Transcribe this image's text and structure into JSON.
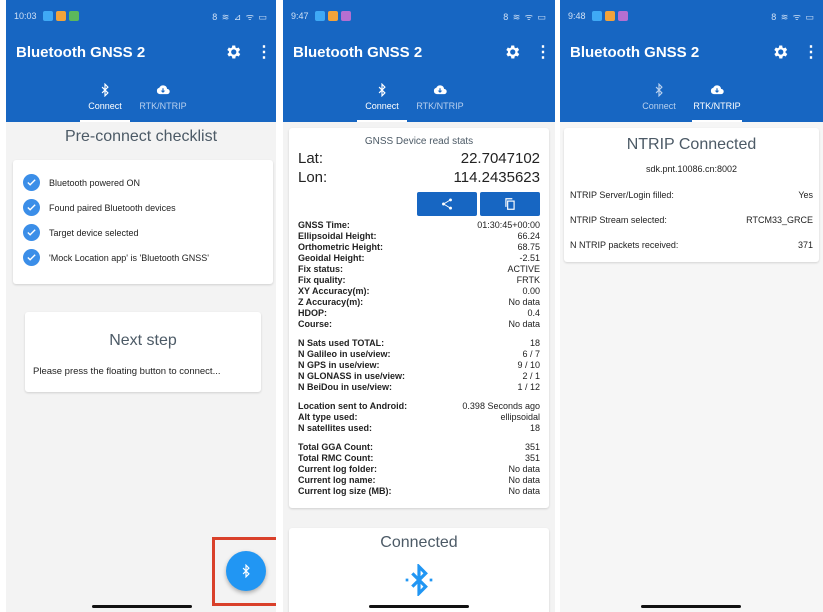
{
  "app": {
    "title": "Bluetooth GNSS 2",
    "more_glyph": "⋮"
  },
  "icons": {
    "settings": "gear-icon",
    "bluetooth": "bluetooth-icon",
    "cloud": "cloud-download-icon",
    "share": "share-icon",
    "copy": "copy-icon",
    "check": "check-circle-icon"
  },
  "colors": {
    "primary": "#1766c2",
    "check": "#3b8ee8",
    "fab": "#2196f3",
    "highlight": "#d9402a"
  },
  "tabs": [
    {
      "label": "Connect"
    },
    {
      "label": "RTK/NTRIP"
    }
  ],
  "screens": [
    {
      "status_time": "10:03",
      "status_right": "8 ≋ ⊿ ᯤ ▭",
      "checklist_title": "Pre-connect checklist",
      "checklist": [
        "Bluetooth powered ON",
        "Found paired Bluetooth devices",
        "Target device selected",
        "'Mock Location app' is 'Bluetooth GNSS'"
      ],
      "next_title": "Next step",
      "next_text": "Please press the floating button to connect..."
    },
    {
      "status_time": "9:47",
      "status_right": "8 ≋ ᯤ ▭",
      "stats_title": "GNSS Device read stats",
      "lat_label": "Lat:",
      "lat_value": "22.7047102",
      "lon_label": "Lon:",
      "lon_value": "114.2435623",
      "groups": [
        [
          [
            "GNSS Time:",
            "01:30:45+00:00"
          ],
          [
            "Ellipsoidal Height:",
            "66.24"
          ],
          [
            "Orthometric Height:",
            "68.75"
          ],
          [
            "Geoidal Height:",
            "-2.51"
          ],
          [
            "Fix status:",
            "ACTIVE"
          ],
          [
            "Fix quality:",
            "FRTK"
          ],
          [
            "XY Accuracy(m):",
            "0.00"
          ],
          [
            "Z Accuracy(m):",
            "No data"
          ],
          [
            "HDOP:",
            "0.4"
          ],
          [
            "Course:",
            "No data"
          ]
        ],
        [
          [
            "N Sats used TOTAL:",
            "18"
          ],
          [
            "N Galileo in use/view:",
            "6 / 7"
          ],
          [
            "N GPS in use/view:",
            "9 / 10"
          ],
          [
            "N GLONASS in use/view:",
            "2 / 1"
          ],
          [
            "N BeiDou in use/view:",
            "1 / 12"
          ]
        ],
        [
          [
            "Location sent to Android:",
            "0.398 Seconds ago"
          ],
          [
            "Alt type used:",
            "ellipsoidal"
          ],
          [
            "N satellites used:",
            "18"
          ]
        ],
        [
          [
            "Total GGA Count:",
            "351"
          ],
          [
            "Total RMC Count:",
            "351"
          ],
          [
            "Current log folder:",
            "No data"
          ],
          [
            "Current log name:",
            "No data"
          ],
          [
            "Current log size (MB):",
            "No data"
          ]
        ]
      ],
      "connected_label": "Connected"
    },
    {
      "status_time": "9:48",
      "status_right": "8 ≋ ᯤ ▭",
      "title": "NTRIP Connected",
      "server": "sdk.pnt.10086.cn:8002",
      "rows": [
        [
          "NTRIP Server/Login filled:",
          "Yes"
        ],
        [
          "NTRIP Stream selected:",
          "RTCM33_GRCE"
        ],
        [
          "N NTRIP packets received:",
          "371"
        ]
      ]
    }
  ]
}
